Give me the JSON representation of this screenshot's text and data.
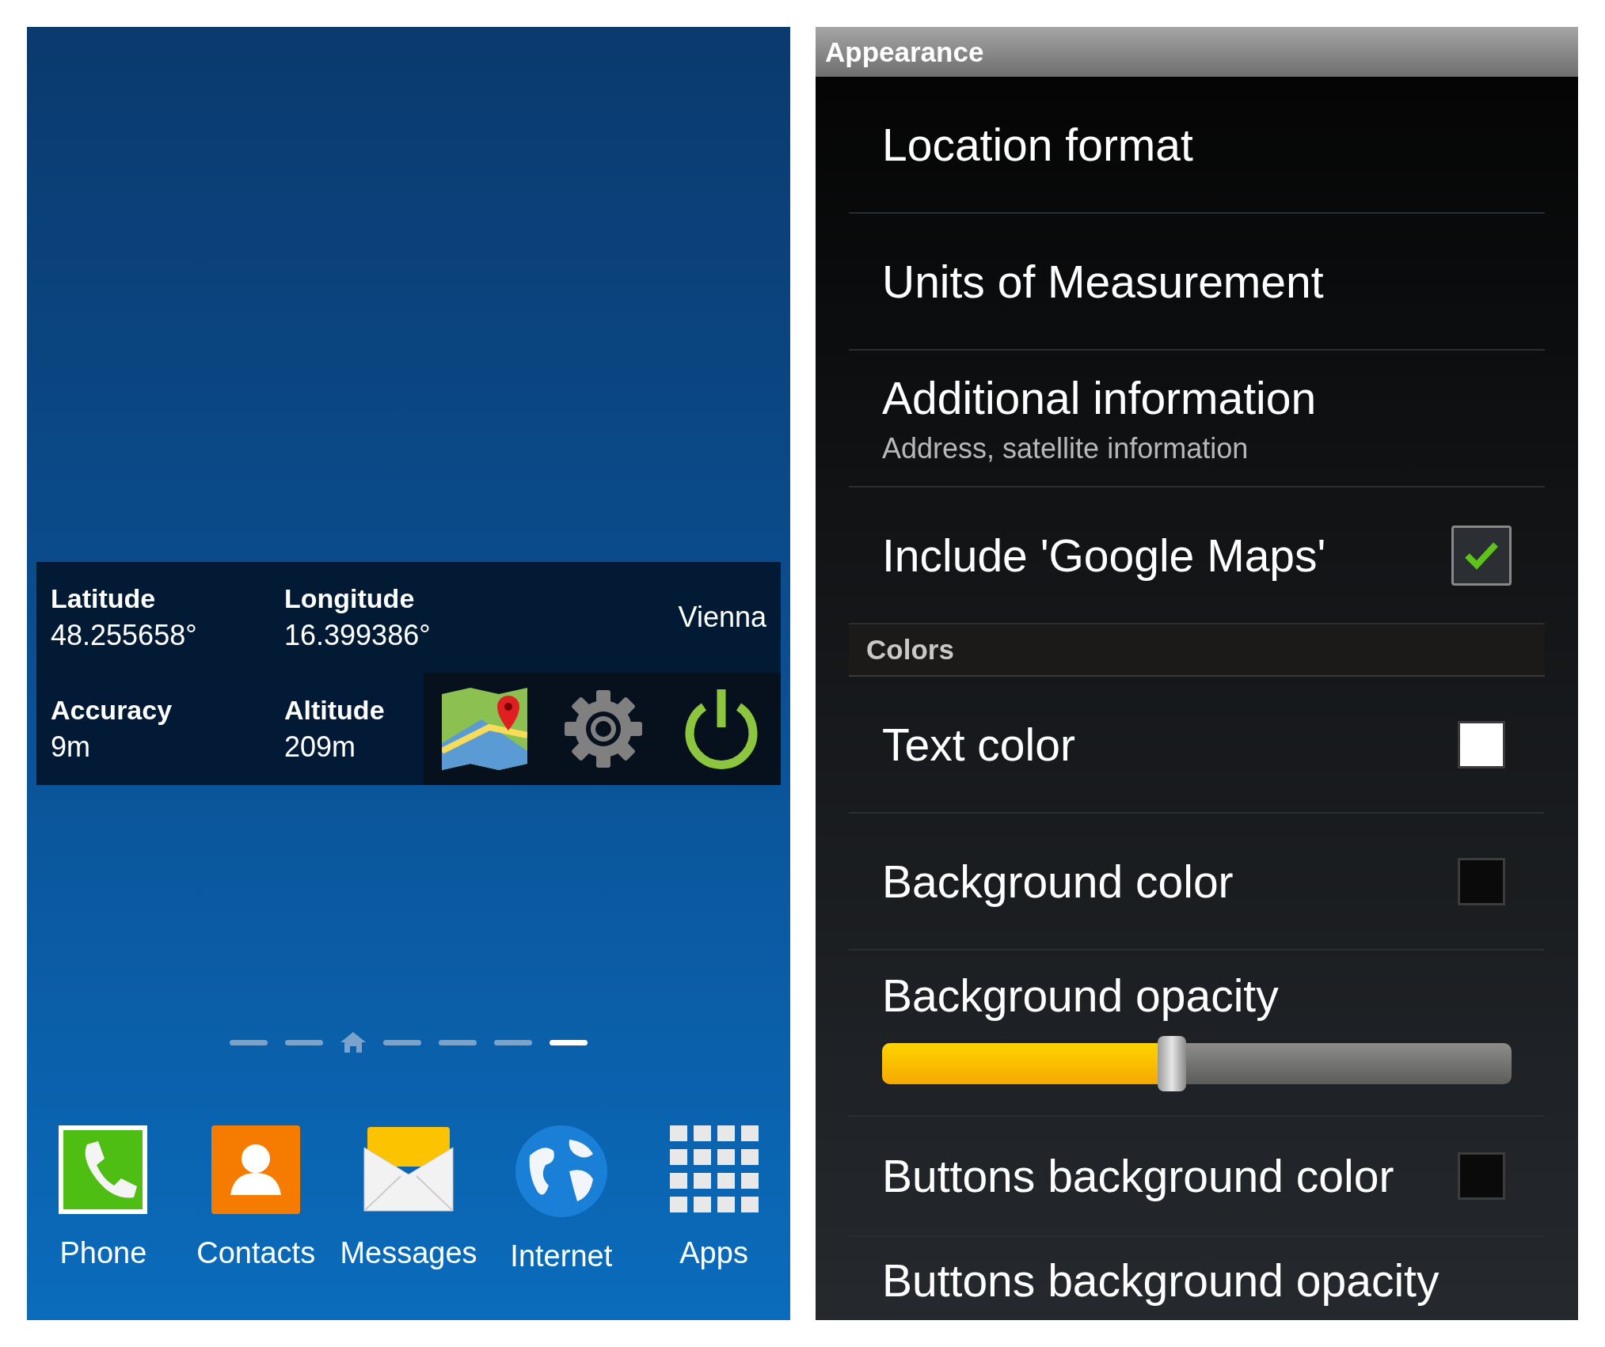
{
  "home_screen": {
    "widget": {
      "fields": [
        {
          "label": "Latitude",
          "value": "48.255658°"
        },
        {
          "label": "Longitude",
          "value": "16.399386°"
        },
        {
          "label": "Accuracy",
          "value": "9m"
        },
        {
          "label": "Altitude",
          "value": "209m"
        }
      ],
      "city": "Vienna"
    },
    "pages": [
      {
        "kind": "dash",
        "selected": false
      },
      {
        "kind": "dash",
        "selected": false
      },
      {
        "kind": "home",
        "selected": false
      },
      {
        "kind": "dash",
        "selected": false
      },
      {
        "kind": "dash",
        "selected": false
      },
      {
        "kind": "dash",
        "selected": false
      },
      {
        "kind": "dash",
        "selected": true
      }
    ],
    "dock": [
      {
        "kind": "phone",
        "label": "Phone"
      },
      {
        "kind": "contacts",
        "label": "Contacts"
      },
      {
        "kind": "messages",
        "label": "Messages"
      },
      {
        "kind": "internet",
        "label": "Internet"
      },
      {
        "kind": "apps",
        "label": "Apps"
      }
    ]
  },
  "settings": {
    "header": "Appearance",
    "items": [
      {
        "kind": "plain",
        "title": "Location format"
      },
      {
        "kind": "plain",
        "title": "Units of Measurement"
      },
      {
        "kind": "plain",
        "title": "Additional information",
        "summary": "Address, satellite information"
      },
      {
        "kind": "checkbox",
        "title": "Include 'Google Maps'",
        "checked": true
      },
      {
        "kind": "category",
        "title": "Colors"
      },
      {
        "kind": "color",
        "title": "Text color",
        "color": "#ffffff"
      },
      {
        "kind": "color",
        "title": "Background color",
        "color": "#0a0a0a"
      },
      {
        "kind": "slider",
        "title": "Background opacity",
        "level": 0.46
      },
      {
        "kind": "color",
        "title": "Buttons background color",
        "color": "#0a0a0a"
      },
      {
        "kind": "plain",
        "title": "Buttons background opacity"
      }
    ]
  }
}
